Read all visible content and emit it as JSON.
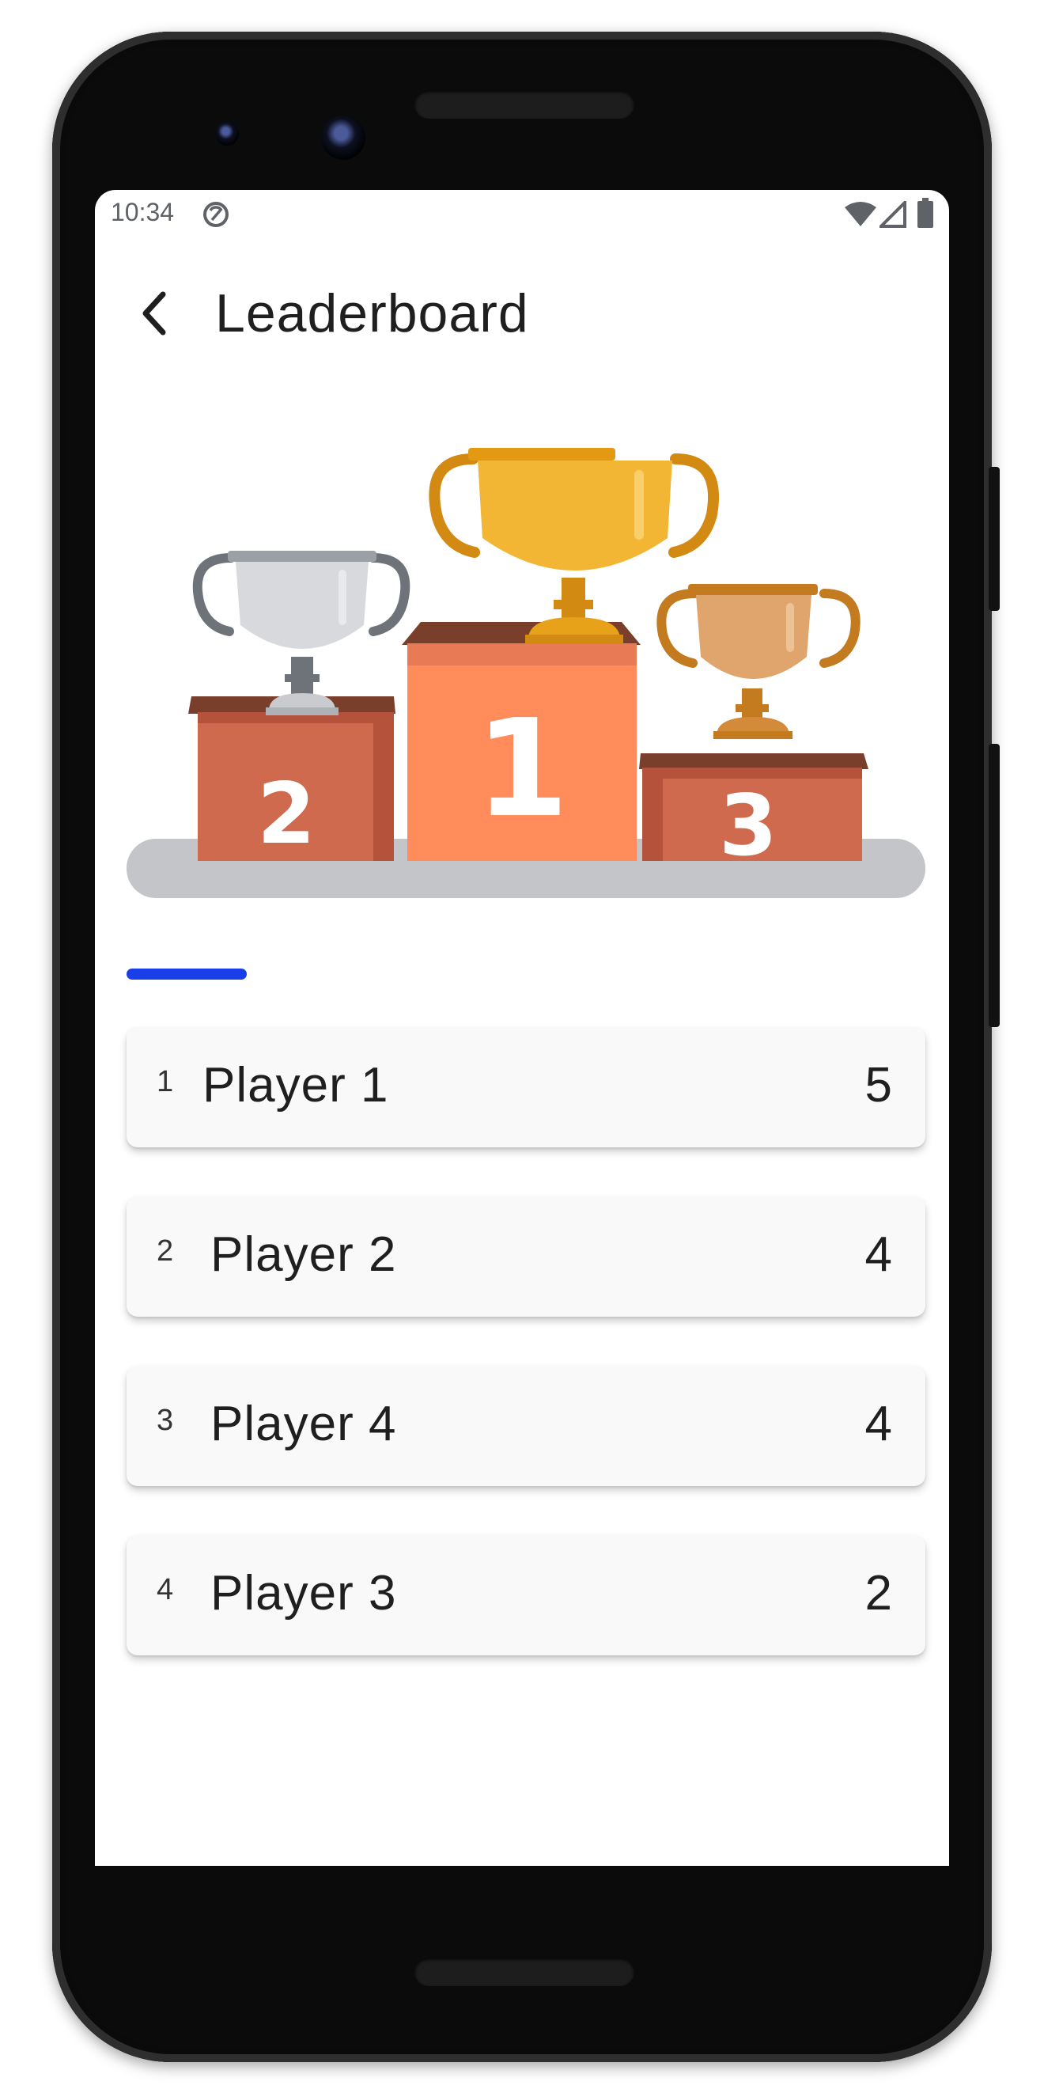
{
  "status_bar": {
    "time": "10:34"
  },
  "app_bar": {
    "title": "Leaderboard"
  },
  "podium": {
    "places": [
      "2",
      "1",
      "3"
    ]
  },
  "colors": {
    "accent": "#1a3fe8",
    "gold": "#f1a91f",
    "silver": "#c8cace",
    "bronze": "#d9934a",
    "podium": "#cf6a4e"
  },
  "leaderboard": [
    {
      "rank": "1",
      "name": "Player 1",
      "score": "5"
    },
    {
      "rank": "2",
      "name": "Player 2",
      "score": "4"
    },
    {
      "rank": "3",
      "name": "Player 4",
      "score": "4"
    },
    {
      "rank": "4",
      "name": "Player 3",
      "score": "2"
    }
  ]
}
